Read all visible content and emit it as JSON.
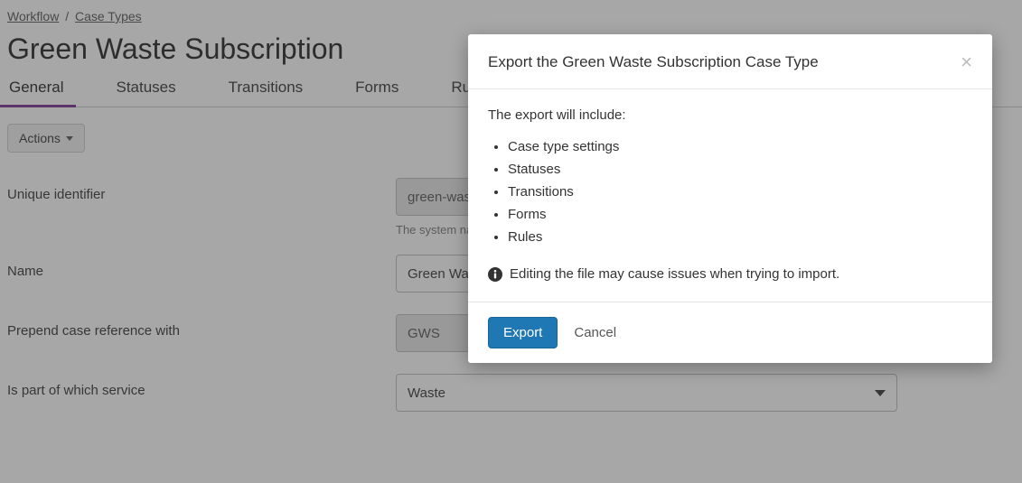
{
  "breadcrumb": {
    "root": "Workflow",
    "section": "Case Types"
  },
  "page": {
    "title": "Green Waste Subscription"
  },
  "tabs": [
    "General",
    "Statuses",
    "Transitions",
    "Forms",
    "Rules"
  ],
  "active_tab_index": 0,
  "actions_button": "Actions",
  "form": {
    "unique_identifier": {
      "label": "Unique identifier",
      "value": "green-waste-subscription",
      "help": "The system name for this case type. Usually does not need changing."
    },
    "name": {
      "label": "Name",
      "value": "Green Waste Subscription"
    },
    "prepend": {
      "label": "Prepend case reference with",
      "value": "GWS"
    },
    "service": {
      "label": "Is part of which service",
      "value": "Waste"
    }
  },
  "modal": {
    "title": "Export the Green Waste Subscription Case Type",
    "intro": "The export will include:",
    "items": [
      "Case type settings",
      "Statuses",
      "Transitions",
      "Forms",
      "Rules"
    ],
    "warning": "Editing the file may cause issues when trying to import.",
    "export_label": "Export",
    "cancel_label": "Cancel"
  }
}
